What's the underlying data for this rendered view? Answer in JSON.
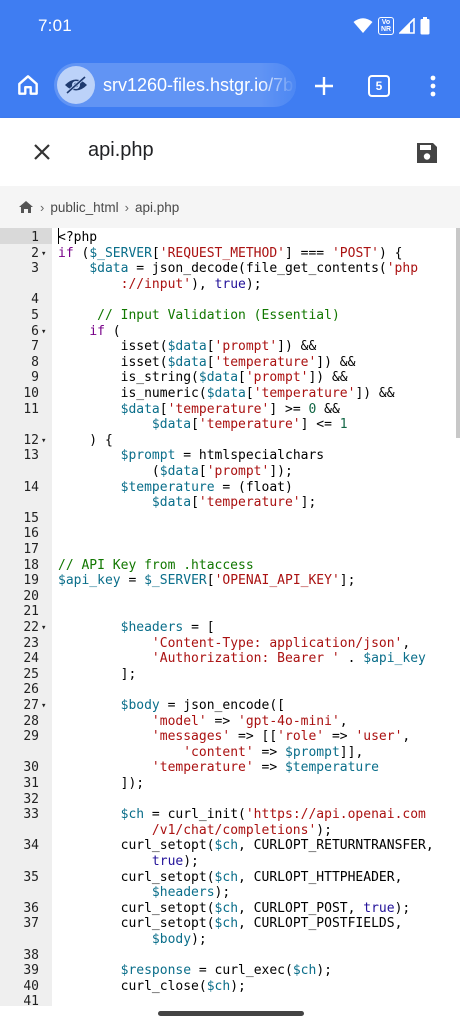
{
  "status_bar": {
    "time": "7:01",
    "network_badge_top": "Vo",
    "network_badge_bottom": "NR",
    "icons": [
      "wifi-icon",
      "volte-icon",
      "signal-icon",
      "battery-icon"
    ]
  },
  "browser": {
    "url": "srv1260-files.hstgr.io/7b",
    "tab_count": "5",
    "accent_color": "#3f7df2"
  },
  "editor": {
    "file_name": "api.php"
  },
  "breadcrumb": {
    "items": [
      "public_html",
      "api.php"
    ]
  },
  "code": {
    "lines": [
      {
        "n": "1",
        "fold": false
      },
      {
        "n": "2",
        "fold": true
      },
      {
        "n": "3",
        "fold": false
      },
      {
        "n": "",
        "fold": false
      },
      {
        "n": "4",
        "fold": false
      },
      {
        "n": "5",
        "fold": false
      },
      {
        "n": "6",
        "fold": true
      },
      {
        "n": "7",
        "fold": false
      },
      {
        "n": "8",
        "fold": false
      },
      {
        "n": "9",
        "fold": false
      },
      {
        "n": "10",
        "fold": false
      },
      {
        "n": "11",
        "fold": false
      },
      {
        "n": "",
        "fold": false
      },
      {
        "n": "12",
        "fold": true
      },
      {
        "n": "13",
        "fold": false
      },
      {
        "n": "",
        "fold": false
      },
      {
        "n": "14",
        "fold": false
      },
      {
        "n": "",
        "fold": false
      },
      {
        "n": "15",
        "fold": false
      },
      {
        "n": "16",
        "fold": false
      },
      {
        "n": "17",
        "fold": false
      },
      {
        "n": "18",
        "fold": false
      },
      {
        "n": "19",
        "fold": false
      },
      {
        "n": "20",
        "fold": false
      },
      {
        "n": "21",
        "fold": false
      },
      {
        "n": "22",
        "fold": true
      },
      {
        "n": "23",
        "fold": false
      },
      {
        "n": "24",
        "fold": false
      },
      {
        "n": "25",
        "fold": false
      },
      {
        "n": "26",
        "fold": false
      },
      {
        "n": "27",
        "fold": true
      },
      {
        "n": "28",
        "fold": false
      },
      {
        "n": "29",
        "fold": false
      },
      {
        "n": "",
        "fold": false
      },
      {
        "n": "30",
        "fold": false
      },
      {
        "n": "31",
        "fold": false
      },
      {
        "n": "32",
        "fold": false
      },
      {
        "n": "33",
        "fold": false
      },
      {
        "n": "",
        "fold": false
      },
      {
        "n": "34",
        "fold": false
      },
      {
        "n": "",
        "fold": false
      },
      {
        "n": "35",
        "fold": false
      },
      {
        "n": "",
        "fold": false
      },
      {
        "n": "36",
        "fold": false
      },
      {
        "n": "37",
        "fold": false
      },
      {
        "n": "",
        "fold": false
      },
      {
        "n": "38",
        "fold": false
      },
      {
        "n": "39",
        "fold": false
      },
      {
        "n": "40",
        "fold": false
      },
      {
        "n": "41",
        "fold": false
      }
    ],
    "tokens": [
      [
        [
          "",
          "<?php"
        ]
      ],
      [
        [
          "kw",
          "if"
        ],
        [
          "",
          " ("
        ],
        [
          "vr",
          "$_SERVER"
        ],
        [
          "",
          "["
        ],
        [
          "st",
          "'REQUEST_METHOD'"
        ],
        [
          "",
          "] === "
        ],
        [
          "st",
          "'POST'"
        ],
        [
          "",
          ") {"
        ]
      ],
      [
        [
          "",
          "    "
        ],
        [
          "vr",
          "$data"
        ],
        [
          "",
          " = json_decode(file_get_contents("
        ],
        [
          "st",
          "'php"
        ]
      ],
      [
        [
          "",
          "        "
        ],
        [
          "st",
          "://input'"
        ],
        [
          "",
          "), "
        ],
        [
          "at",
          "true"
        ],
        [
          "",
          ");"
        ]
      ],
      [],
      [
        [
          "",
          "     "
        ],
        [
          "cm",
          "// Input Validation (Essential)"
        ]
      ],
      [
        [
          "",
          "    "
        ],
        [
          "kw",
          "if"
        ],
        [
          "",
          " ("
        ]
      ],
      [
        [
          "",
          "        isset("
        ],
        [
          "vr",
          "$data"
        ],
        [
          "",
          "["
        ],
        [
          "st",
          "'prompt'"
        ],
        [
          "",
          "]) &&"
        ]
      ],
      [
        [
          "",
          "        isset("
        ],
        [
          "vr",
          "$data"
        ],
        [
          "",
          "["
        ],
        [
          "st",
          "'temperature'"
        ],
        [
          "",
          "]) &&"
        ]
      ],
      [
        [
          "",
          "        is_string("
        ],
        [
          "vr",
          "$data"
        ],
        [
          "",
          "["
        ],
        [
          "st",
          "'prompt'"
        ],
        [
          "",
          "]) &&"
        ]
      ],
      [
        [
          "",
          "        is_numeric("
        ],
        [
          "vr",
          "$data"
        ],
        [
          "",
          "["
        ],
        [
          "st",
          "'temperature'"
        ],
        [
          "",
          "]) &&"
        ]
      ],
      [
        [
          "",
          "        "
        ],
        [
          "vr",
          "$data"
        ],
        [
          "",
          "["
        ],
        [
          "st",
          "'temperature'"
        ],
        [
          "",
          "] >= "
        ],
        [
          "nm",
          "0"
        ],
        [
          "",
          " &&"
        ]
      ],
      [
        [
          "",
          "            "
        ],
        [
          "vr",
          "$data"
        ],
        [
          "",
          "["
        ],
        [
          "st",
          "'temperature'"
        ],
        [
          "",
          "] <= "
        ],
        [
          "nm",
          "1"
        ]
      ],
      [
        [
          "",
          "    ) {"
        ]
      ],
      [
        [
          "",
          "        "
        ],
        [
          "vr",
          "$prompt"
        ],
        [
          "",
          " = htmlspecialchars"
        ]
      ],
      [
        [
          "",
          "            ("
        ],
        [
          "vr",
          "$data"
        ],
        [
          "",
          "["
        ],
        [
          "st",
          "'prompt'"
        ],
        [
          "",
          "]);"
        ]
      ],
      [
        [
          "",
          "        "
        ],
        [
          "vr",
          "$temperature"
        ],
        [
          "",
          " = (float)"
        ]
      ],
      [
        [
          "",
          "            "
        ],
        [
          "vr",
          "$data"
        ],
        [
          "",
          "["
        ],
        [
          "st",
          "'temperature'"
        ],
        [
          "",
          "];"
        ]
      ],
      [],
      [],
      [],
      [
        [
          "cm",
          "// API Key from .htaccess"
        ]
      ],
      [
        [
          "vr",
          "$api_key"
        ],
        [
          "",
          " = "
        ],
        [
          "vr",
          "$_SERVER"
        ],
        [
          "",
          "["
        ],
        [
          "st",
          "'OPENAI_API_KEY'"
        ],
        [
          "",
          "];"
        ]
      ],
      [],
      [],
      [
        [
          "",
          "        "
        ],
        [
          "vr",
          "$headers"
        ],
        [
          "",
          " = ["
        ]
      ],
      [
        [
          "",
          "            "
        ],
        [
          "st",
          "'Content-Type: application/json'"
        ],
        [
          "",
          ","
        ]
      ],
      [
        [
          "",
          "            "
        ],
        [
          "st",
          "'Authorization: Bearer '"
        ],
        [
          "",
          " . "
        ],
        [
          "vr",
          "$api_key"
        ]
      ],
      [
        [
          "",
          "        ];"
        ]
      ],
      [],
      [
        [
          "",
          "        "
        ],
        [
          "vr",
          "$body"
        ],
        [
          "",
          " = json_encode(["
        ]
      ],
      [
        [
          "",
          "            "
        ],
        [
          "st",
          "'model'"
        ],
        [
          "",
          " => "
        ],
        [
          "st",
          "'gpt-4o-mini'"
        ],
        [
          "",
          ","
        ]
      ],
      [
        [
          "",
          "            "
        ],
        [
          "st",
          "'messages'"
        ],
        [
          "",
          " => [["
        ],
        [
          "st",
          "'role'"
        ],
        [
          "",
          " => "
        ],
        [
          "st",
          "'user'"
        ],
        [
          "",
          ","
        ]
      ],
      [
        [
          "",
          "                "
        ],
        [
          "st",
          "'content'"
        ],
        [
          "",
          " => "
        ],
        [
          "vr",
          "$prompt"
        ],
        [
          "",
          "]],"
        ]
      ],
      [
        [
          "",
          "            "
        ],
        [
          "st",
          "'temperature'"
        ],
        [
          "",
          " => "
        ],
        [
          "vr",
          "$temperature"
        ]
      ],
      [
        [
          "",
          "        ]);"
        ]
      ],
      [],
      [
        [
          "",
          "        "
        ],
        [
          "vr",
          "$ch"
        ],
        [
          "",
          " = curl_init("
        ],
        [
          "st",
          "'https://api.openai.com"
        ]
      ],
      [
        [
          "",
          "            "
        ],
        [
          "st",
          "/v1/chat/completions'"
        ],
        [
          "",
          ");"
        ]
      ],
      [
        [
          "",
          "        curl_setopt("
        ],
        [
          "vr",
          "$ch"
        ],
        [
          "",
          ", CURLOPT_RETURNTRANSFER,"
        ]
      ],
      [
        [
          "",
          "            "
        ],
        [
          "at",
          "true"
        ],
        [
          "",
          ");"
        ]
      ],
      [
        [
          "",
          "        curl_setopt("
        ],
        [
          "vr",
          "$ch"
        ],
        [
          "",
          ", CURLOPT_HTTPHEADER,"
        ]
      ],
      [
        [
          "",
          "            "
        ],
        [
          "vr",
          "$headers"
        ],
        [
          "",
          ");"
        ]
      ],
      [
        [
          "",
          "        curl_setopt("
        ],
        [
          "vr",
          "$ch"
        ],
        [
          "",
          ", CURLOPT_POST, "
        ],
        [
          "at",
          "true"
        ],
        [
          "",
          ");"
        ]
      ],
      [
        [
          "",
          "        curl_setopt("
        ],
        [
          "vr",
          "$ch"
        ],
        [
          "",
          ", CURLOPT_POSTFIELDS,"
        ]
      ],
      [
        [
          "",
          "            "
        ],
        [
          "vr",
          "$body"
        ],
        [
          "",
          ");"
        ]
      ],
      [],
      [
        [
          "",
          "        "
        ],
        [
          "vr",
          "$response"
        ],
        [
          "",
          " = curl_exec("
        ],
        [
          "vr",
          "$ch"
        ],
        [
          "",
          ");"
        ]
      ],
      [
        [
          "",
          "        curl_close("
        ],
        [
          "vr",
          "$ch"
        ],
        [
          "",
          ");"
        ]
      ],
      []
    ]
  }
}
